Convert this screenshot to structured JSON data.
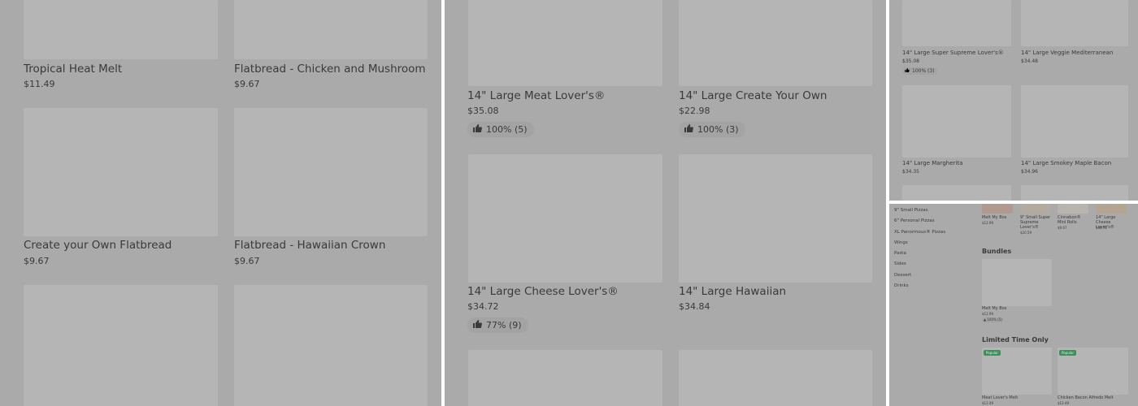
{
  "panel1": {
    "items": [
      {
        "name": "Tropical Heat Melt",
        "price": "$11.49"
      },
      {
        "name": "Flatbread - Chicken and Mushroom",
        "price": "$9.67"
      },
      {
        "name": "Create your Own Flatbread",
        "price": "$9.67"
      },
      {
        "name": "Flatbread - Hawaiian Crown",
        "price": "$9.67"
      }
    ]
  },
  "panel2": {
    "items": [
      {
        "name": "14\" Large Meat Lover's®",
        "price": "$35.08",
        "rating": "100% (5)"
      },
      {
        "name": "14\" Large Create Your Own",
        "price": "$22.98",
        "rating": "100% (3)"
      },
      {
        "name": "14\" Large Cheese Lover's®",
        "price": "$34.72",
        "rating": "77% (9)"
      },
      {
        "name": "14\" Large Hawaiian",
        "price": "$34.84"
      }
    ]
  },
  "panel3": {
    "items": [
      {
        "name": "14\" Large Super Supreme Lover's®",
        "price": "$35.08",
        "rating": "100% (3)"
      },
      {
        "name": "14\" Large Veggie Mediterranean",
        "price": "$34.48"
      },
      {
        "name": "14\" Large Margherita",
        "price": "$34.35"
      },
      {
        "name": "14\" Large Smokey Maple Bacon",
        "price": "$34.96"
      }
    ]
  },
  "panel4": {
    "nav": [
      "9\" Small Pizzas",
      "6\" Personal Pizzas",
      "XL Panormous® Pizzas",
      "Wings",
      "Pasta",
      "Sides",
      "Dessert",
      "Drinks"
    ],
    "top_items": [
      {
        "name": "Melt My Box",
        "price": "$12.99"
      },
      {
        "name": "9\" Small Super Supreme Lover's®",
        "price": "$20.59"
      },
      {
        "name": "Cinnabon® Mini Rolls",
        "price": "$9.67"
      },
      {
        "name": "14\" Large Cheese Lover's®",
        "price": "$34.72"
      }
    ],
    "bundles_heading": "Bundles",
    "bundle": {
      "name": "Melt My Box",
      "price": "$12.99",
      "rating": "100% (5)"
    },
    "limited_heading": "Limited Time Only",
    "limited_items": [
      {
        "badge": "Popular",
        "name": "Meat Lover's Melt",
        "price": "$12.49"
      },
      {
        "badge": "Popular",
        "name": "Chicken Bacon Alfredo Melt",
        "price": "$12.49"
      }
    ]
  }
}
